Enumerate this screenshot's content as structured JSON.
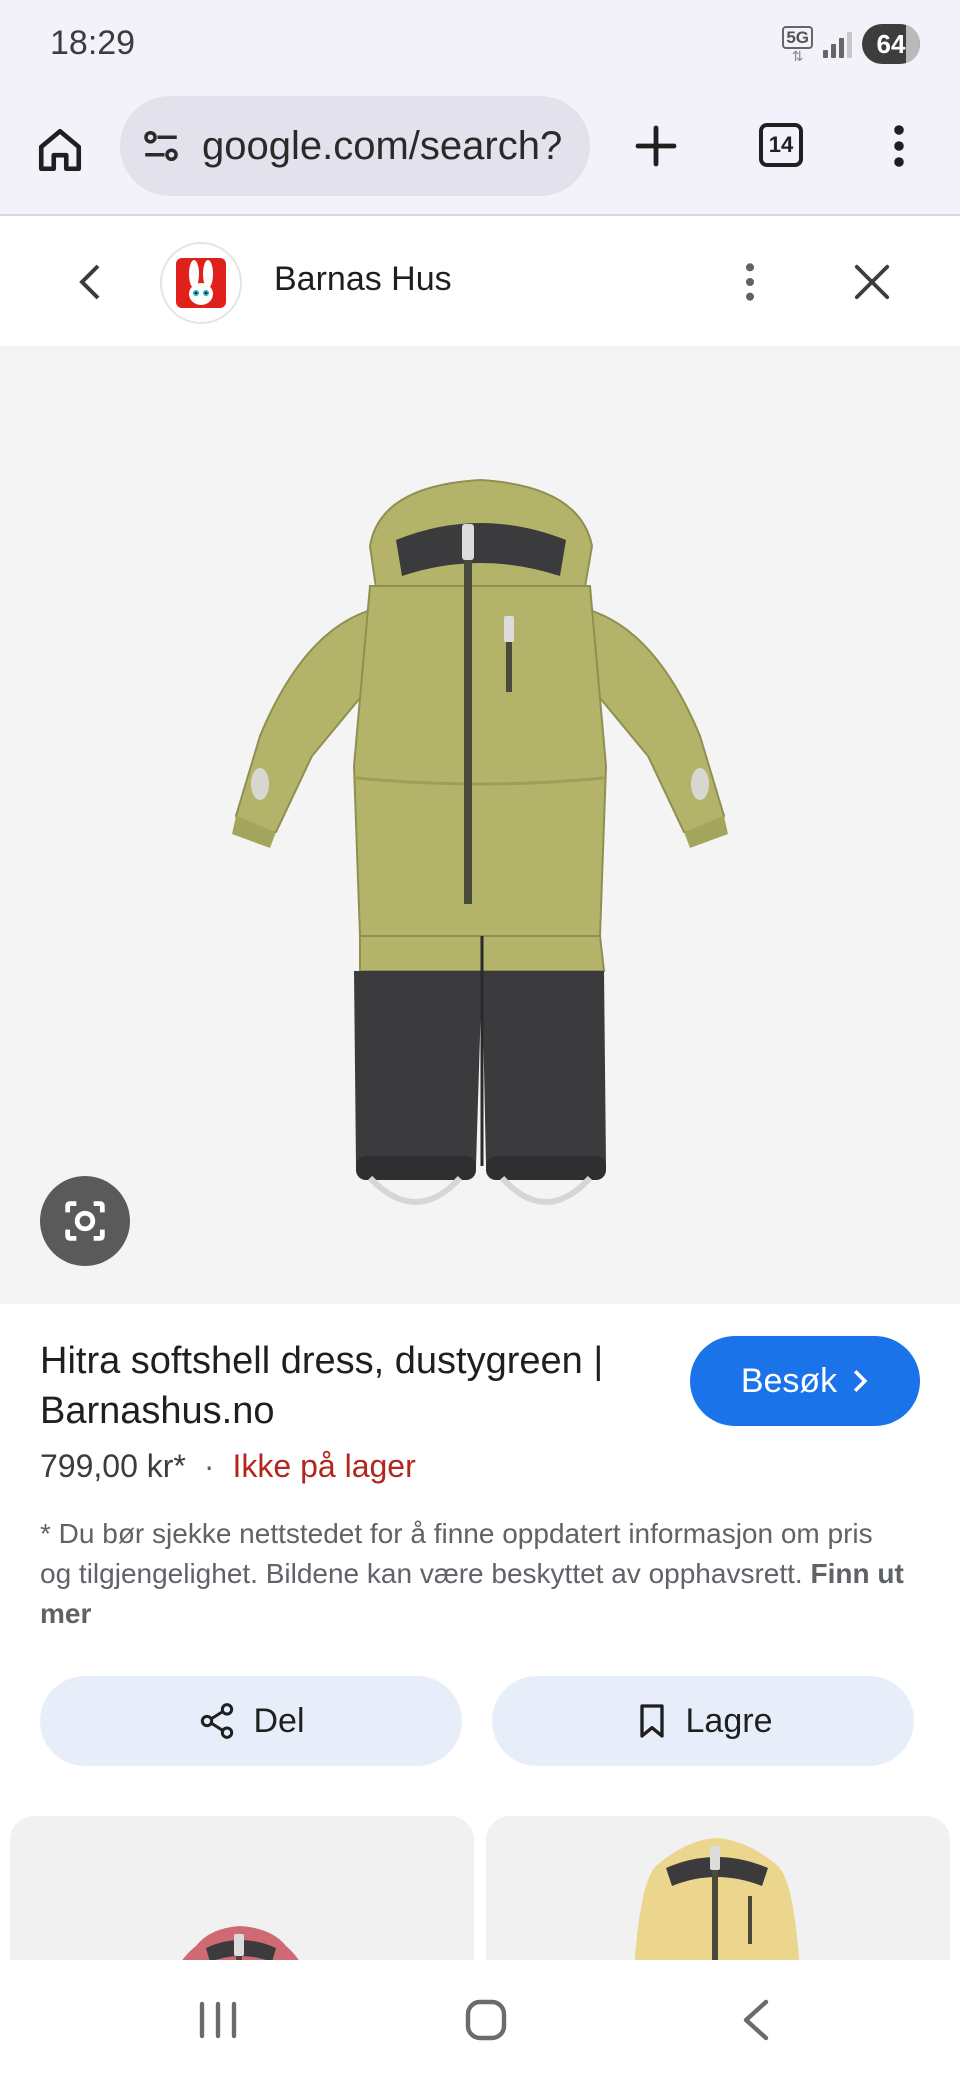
{
  "status_bar": {
    "time": "18:29",
    "network": "5G",
    "battery": "64"
  },
  "browser": {
    "url": "google.com/search?",
    "tab_count": "14",
    "icons": {
      "home": "home-icon",
      "site_info": "tune-icon",
      "new_tab": "plus-icon",
      "tabs": "tab-switcher-icon",
      "menu": "more-vert-icon"
    }
  },
  "sheet": {
    "site_name": "Barnas Hus",
    "icons": {
      "back": "chevron-left-icon",
      "more": "more-vert-icon",
      "close": "close-icon"
    }
  },
  "product": {
    "image_alt": "Hitra softshell dress",
    "title": "Hitra softshell dress, dustygreen | Barnashus.no",
    "visit_label": "Besøk",
    "price": "799,00 kr*",
    "separator": "·",
    "stock_status": "Ikke på lager",
    "disclaimer": "* Du bør sjekke nettstedet for å finne oppdatert informasjon om pris og tilgjengelighet. Bildene kan være beskyttet av opphavsrett.",
    "learn_more": "Finn ut mer",
    "colors": {
      "garment": "#b3b46a",
      "garment_dark": "#3b3b3e",
      "visit_button": "#1a73e8",
      "stock": "#b3261e"
    }
  },
  "actions": {
    "share_label": "Del",
    "save_label": "Lagre"
  },
  "nav": {
    "icons": [
      "recents-icon",
      "home-outline-icon",
      "back-icon"
    ]
  }
}
